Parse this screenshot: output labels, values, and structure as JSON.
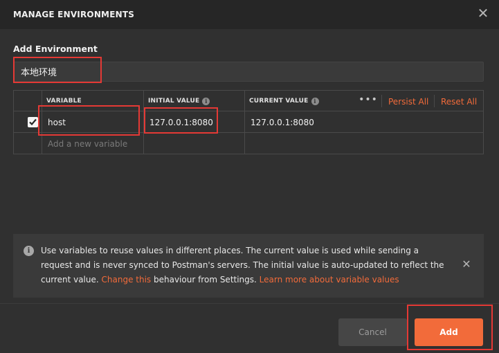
{
  "header": {
    "title": "MANAGE ENVIRONMENTS",
    "close_icon": "close-icon"
  },
  "form": {
    "section_label": "Add Environment",
    "name_value": "本地环境",
    "name_placeholder": ""
  },
  "table": {
    "columns": {
      "variable": "VARIABLE",
      "initial_value": "INITIAL VALUE",
      "current_value": "CURRENT VALUE"
    },
    "more_icon": "more-icon",
    "persist_all": "Persist All",
    "reset_all": "Reset All",
    "rows": [
      {
        "enabled": true,
        "variable": "host",
        "initial_value": "127.0.0.1:8080",
        "current_value": "127.0.0.1:8080"
      }
    ],
    "new_variable_placeholder": "Add a new variable"
  },
  "notice": {
    "text_before": "Use variables to reuse values in different places. The current value is used while sending a request and is never synced to Postman's servers. The initial value is auto-updated to reflect the current value. ",
    "change_link": "Change this",
    "text_middle": " behaviour from Settings. ",
    "learn_link": "Learn more about variable values"
  },
  "footer": {
    "cancel_label": "Cancel",
    "add_label": "Add"
  },
  "colors": {
    "accent": "#f26b3a",
    "highlight": "#e53935",
    "background": "#303030"
  }
}
